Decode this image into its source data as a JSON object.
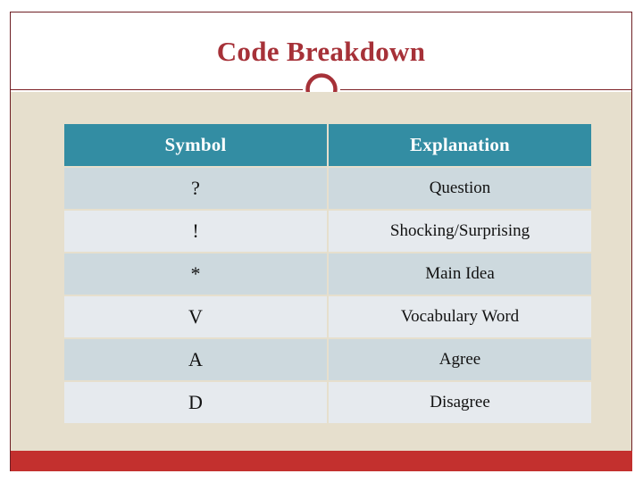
{
  "slide": {
    "title": "Code Breakdown",
    "ornament_icon": "circle-ring-icon"
  },
  "colors": {
    "title_red": "#a63138",
    "rule_red": "#7d2126",
    "frame_red": "#6e1f24",
    "bottom_bar_red": "#c3302e",
    "panel_beige": "#e6dfcd",
    "header_teal": "#338da3",
    "row_dark": "#cdd9de",
    "row_light": "#e6eaee",
    "header_text": "#ffffff",
    "body_text": "#121212"
  },
  "table": {
    "headers": [
      "Symbol",
      "Explanation"
    ],
    "rows": [
      {
        "symbol": "?",
        "explanation": "Question"
      },
      {
        "symbol": "!",
        "explanation": "Shocking/Surprising"
      },
      {
        "symbol": "*",
        "explanation": "Main Idea"
      },
      {
        "symbol": "V",
        "explanation": "Vocabulary Word"
      },
      {
        "symbol": "A",
        "explanation": "Agree"
      },
      {
        "symbol": "D",
        "explanation": "Disagree"
      }
    ]
  }
}
